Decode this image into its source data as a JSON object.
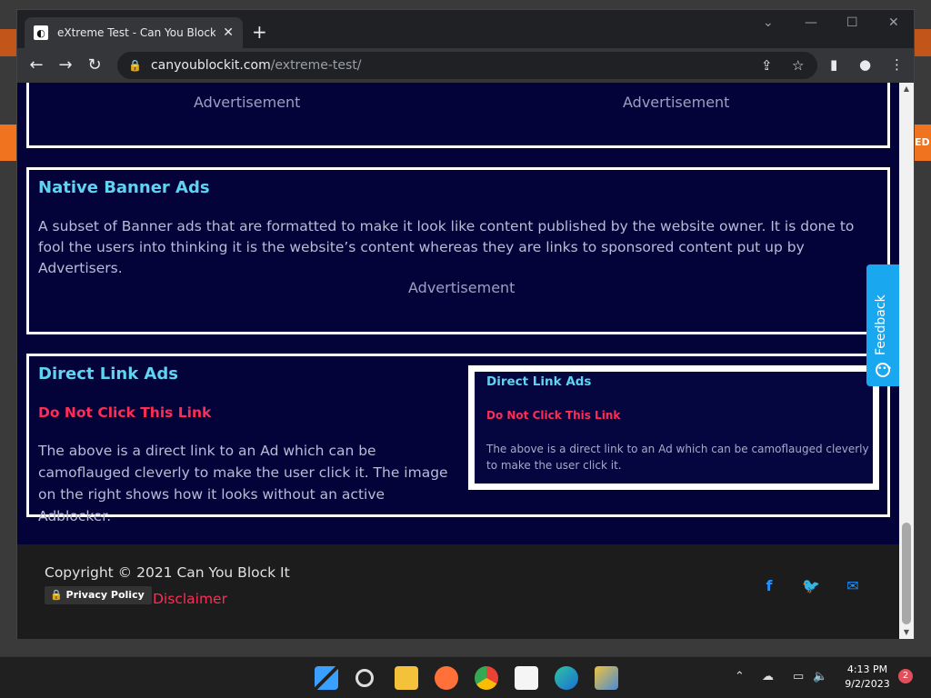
{
  "browser": {
    "tab_title": "eXtreme Test - Can You Block It ?",
    "tab_close": "✕",
    "new_tab": "+",
    "url_host": "canyoublockit.com",
    "url_path": "/extreme-test/"
  },
  "page": {
    "top_ads": [
      "Advertisement",
      "Advertisement"
    ],
    "native": {
      "title": "Native Banner Ads",
      "text": "A subset of Banner ads that are formatted to make it look like content published by the website owner. It is done to fool the users into thinking it is the website’s content whereas they are links to sponsored content put up by Advertisers.",
      "ad": "Advertisement"
    },
    "direct": {
      "title": "Direct Link Ads",
      "link": "Do Not Click This Link",
      "text": "The above is a direct link to an Ad which can be camoflauged cleverly to make the user click it. The image on the right shows how it looks without an active Adblocker.",
      "inset_title": "Direct Link Ads",
      "inset_link": "Do Not Click This Link",
      "inset_text": "The above is a direct link to an Ad which can be camoflauged cleverly to make the user click it."
    },
    "feedback": "Feedback",
    "footer": {
      "copyright": "Copyright © 2021 Can You Block It",
      "privacy": "Privacy Policy",
      "disclaimer": "Disclaimer"
    }
  },
  "desktop": {
    "edge_text": "ED"
  },
  "taskbar": {
    "time": "4:13 PM",
    "date": "9/2/2023",
    "notifications": "2"
  },
  "colors": {
    "page_bg": "#03033a",
    "title": "#5fd4f0",
    "link_red": "#ff2d55",
    "feedback": "#19a7f0",
    "social": "#1e90ff"
  }
}
